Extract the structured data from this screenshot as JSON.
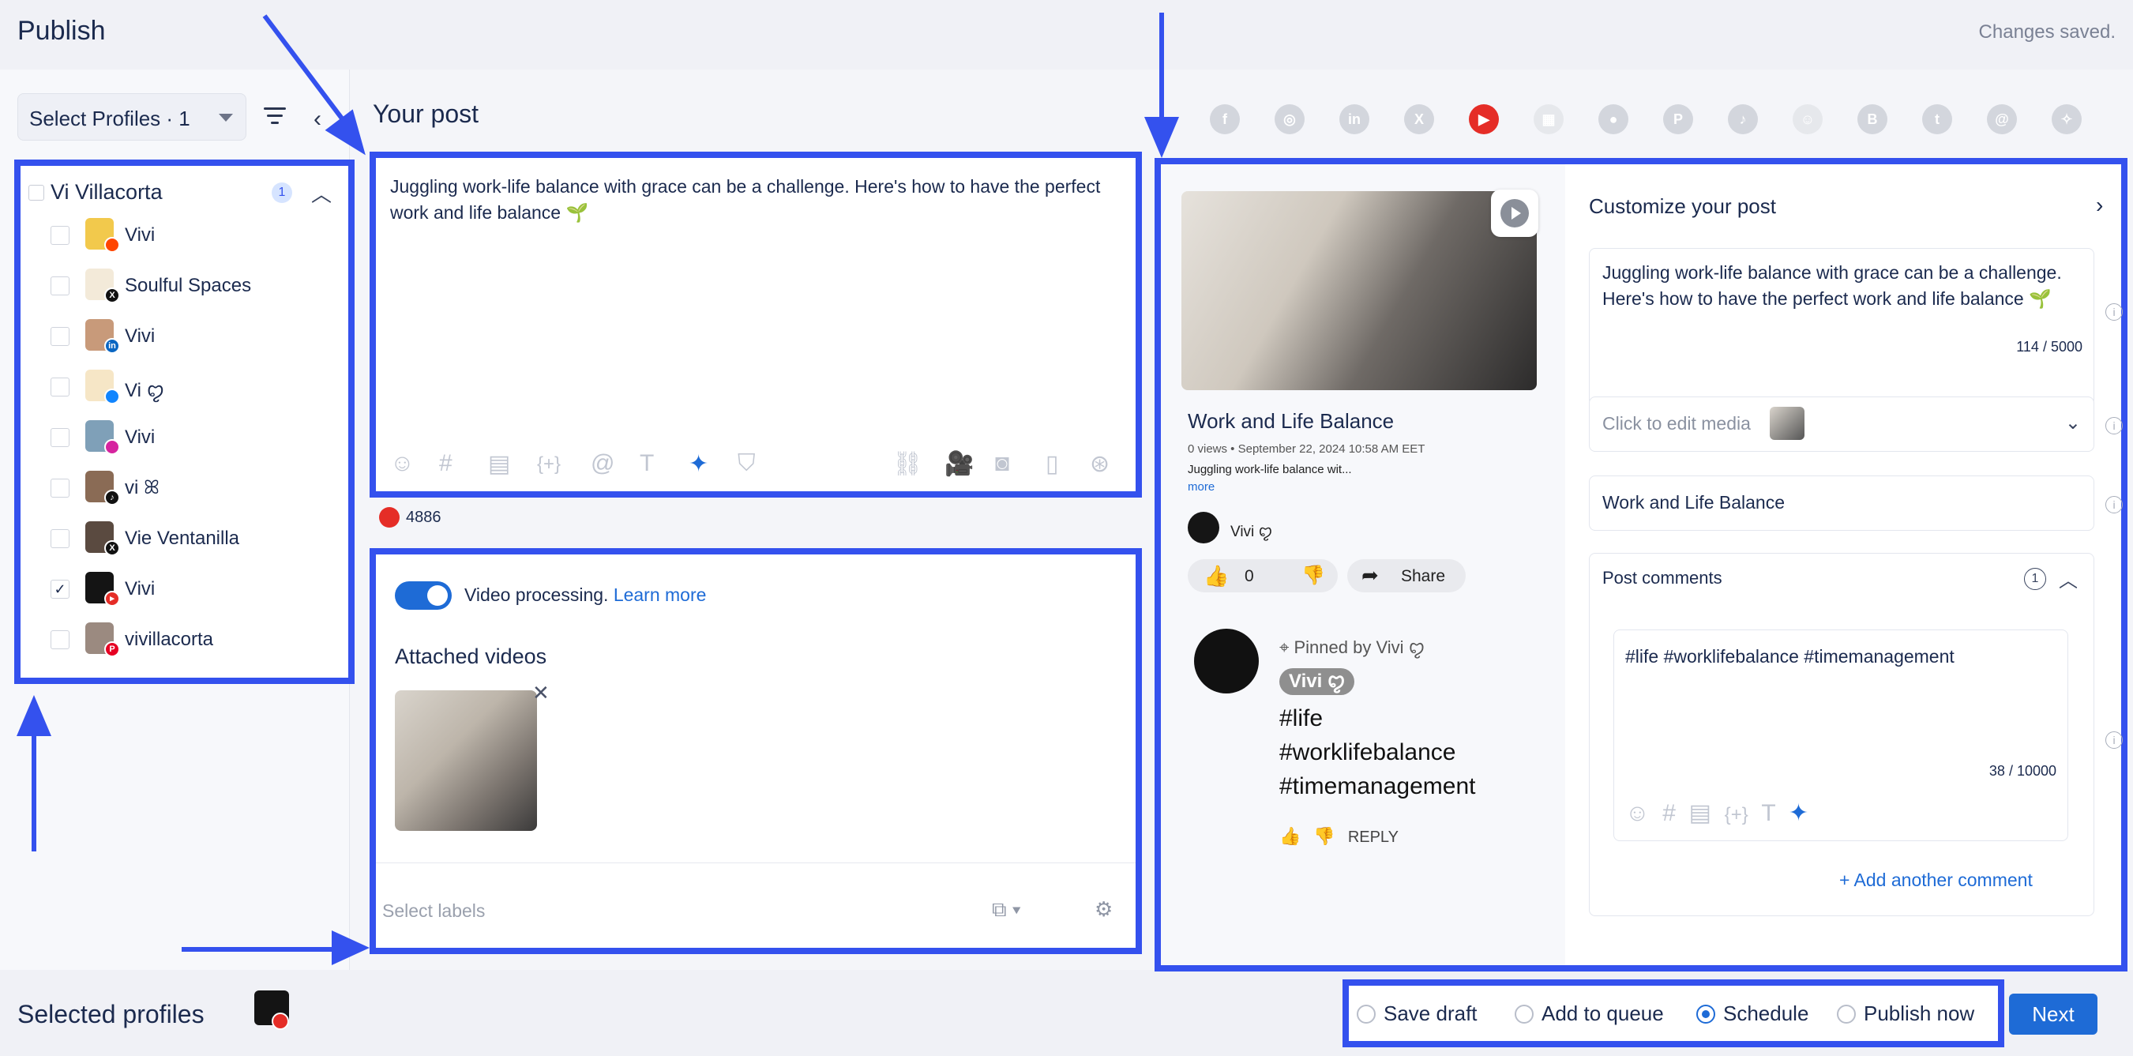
{
  "header": {
    "title": "Publish",
    "status": "Changes saved."
  },
  "profiles": {
    "select_label": "Select Profiles · 1",
    "group": {
      "name": "Vi Villacorta",
      "count": "1"
    },
    "items": [
      {
        "name": "Vivi",
        "network": "reddit",
        "checked": false
      },
      {
        "name": "Soulful Spaces",
        "network": "x",
        "checked": false
      },
      {
        "name": "Vivi",
        "network": "linkedin",
        "checked": false
      },
      {
        "name": "Vi ꨄ",
        "network": "bluesky",
        "checked": false
      },
      {
        "name": "Vivi",
        "network": "instagram",
        "checked": false
      },
      {
        "name": "vi ꕤ",
        "network": "tiktok",
        "checked": false
      },
      {
        "name": "Vie Ventanilla",
        "network": "x",
        "checked": false
      },
      {
        "name": "Vivi",
        "network": "youtube",
        "checked": true
      },
      {
        "name": "vivillacorta",
        "network": "pinterest",
        "checked": false
      }
    ]
  },
  "footer": {
    "selected_label": "Selected profiles"
  },
  "editor": {
    "heading": "Your post",
    "text": "Juggling work-life balance with grace can be a challenge. Here's how to have the perfect work and life balance 🌱",
    "yt_count": "4886"
  },
  "video": {
    "processing_label": "Video processing.",
    "learn_more": "Learn more",
    "attached_heading": "Attached videos",
    "labels_placeholder": "Select labels"
  },
  "preview": {
    "title": "Work and Life Balance",
    "meta": "0 views • September 22, 2024 10:58 AM EET",
    "desc": "Juggling work-life balance wit...",
    "more": "more",
    "channel": "Vivi ꨄ",
    "likes": "0",
    "share": "Share",
    "pinned": "Pinned by Vivi ꨄ",
    "comment_author": "Vivi ꨄ",
    "hashtags": [
      "#life",
      "#worklifebalance",
      "#timemanagement"
    ],
    "reply": "REPLY"
  },
  "customize": {
    "heading": "Customize your post",
    "text": "Juggling work-life balance with grace can be a challenge. Here's how to have the perfect work and life balance 🌱",
    "text_count": "114 / 5000",
    "media_label": "Click to edit media",
    "title_value": "Work and Life Balance",
    "comments_heading": "Post comments",
    "comments_count": "1",
    "comment_text": "#life #worklifebalance #timemanagement",
    "comment_count": "38 / 10000",
    "add_comment": "+ Add another comment"
  },
  "actions": {
    "options": [
      {
        "label": "Save draft",
        "selected": false
      },
      {
        "label": "Add to queue",
        "selected": false
      },
      {
        "label": "Schedule",
        "selected": true
      },
      {
        "label": "Publish now",
        "selected": false
      }
    ],
    "next": "Next"
  },
  "colors": {
    "accent": "#1e6bd6",
    "annotation": "#3451ee",
    "youtube": "#e52d27"
  }
}
